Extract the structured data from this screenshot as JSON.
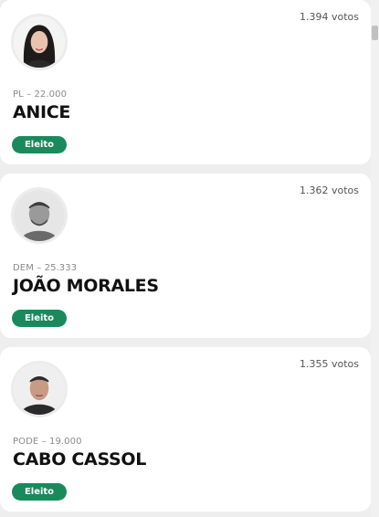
{
  "candidates": [
    {
      "votes": "1.394 votos",
      "party": "PL – 22.000",
      "name": "ANICE",
      "status": "Eleito",
      "photo_icon": "candidate-photo"
    },
    {
      "votes": "1.362 votos",
      "party": "DEM – 25.333",
      "name": "JOÃO MORALES",
      "status": "Eleito",
      "photo_icon": "candidate-photo"
    },
    {
      "votes": "1.355 votos",
      "party": "PODE – 19.000",
      "name": "CABO CASSOL",
      "status": "Eleito",
      "photo_icon": "candidate-photo"
    }
  ],
  "colors": {
    "badge": "#1a8a5c",
    "page_bg": "#eeeeee",
    "card_bg": "#ffffff"
  }
}
